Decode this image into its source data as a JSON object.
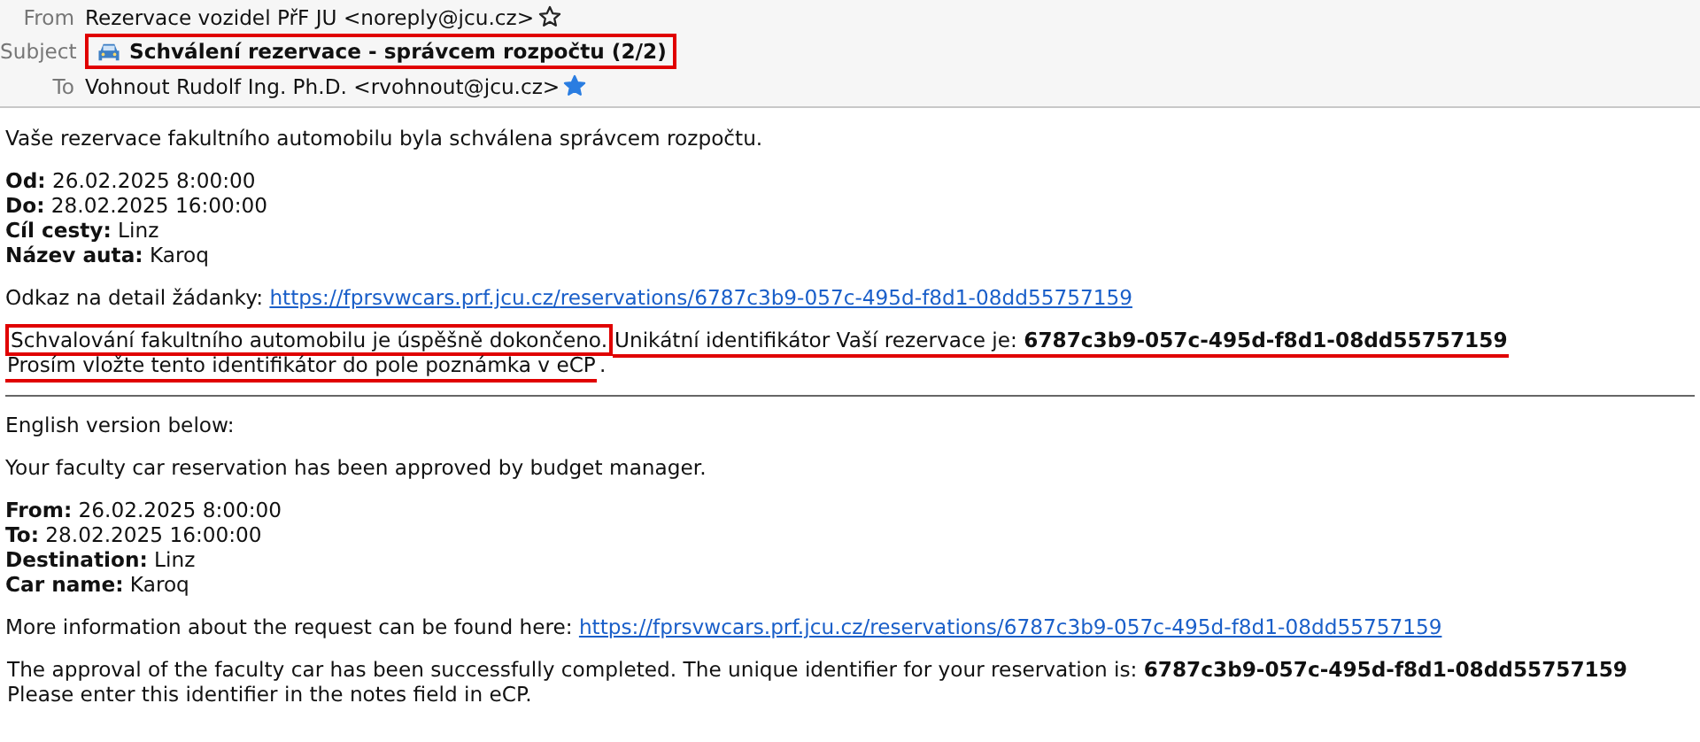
{
  "header": {
    "from": {
      "label": "From",
      "value": "Rezervace vozidel PřF JU <noreply@jcu.cz>",
      "starred": false
    },
    "subject": {
      "label": "Subject",
      "value": "Schválení rezervace - správcem rozpočtu (2/2)",
      "highlighted": true
    },
    "to": {
      "label": "To",
      "value": "Vohnout Rudolf Ing. Ph.D. <rvohnout@jcu.cz>",
      "starred": true
    }
  },
  "sections": [
    {
      "paragraphs": [
        {
          "kind": "text",
          "text": "Vaše rezervace fakultního automobilu byla schválena správcem rozpočtu."
        },
        {
          "kind": "fields",
          "lines": [
            {
              "label": "Od:",
              "value": "26.02.2025 8:00:00"
            },
            {
              "label": "Do:",
              "value": "28.02.2025 16:00:00"
            },
            {
              "label": "Cíl cesty:",
              "value": "Linz"
            },
            {
              "label": "Název auta:",
              "value": "Karoq"
            }
          ]
        },
        {
          "kind": "link",
          "text": "Odkaz na detail žádanky:",
          "url": "https://fprsvwcars.prf.jcu.cz/reservations/6787c3b9-057c-495d-f8d1-08dd55757159"
        },
        {
          "kind": "notice",
          "lines": [
            [
              {
                "text": "Schvalování fakultního automobilu je úspěšně dokončeno.",
                "boxed": true,
                "underlined": false
              },
              {
                "text": "Unikátní identifikátor Vaší rezervace je: **6787c3b9-057c-495d-f8d1-08dd55757159**",
                "boxed": false,
                "underlined": true
              }
            ],
            [
              {
                "text": "Prosím vložte tento identifikátor do pole poznámka v eCP",
                "boxed": false,
                "underlined": true
              },
              {
                "text": ".",
                "boxed": false,
                "underlined": false
              }
            ]
          ]
        }
      ]
    },
    {
      "paragraphs": [
        {
          "kind": "text",
          "text": "English version below:"
        },
        {
          "kind": "text",
          "text": "Your faculty car reservation has been approved by budget manager."
        },
        {
          "kind": "fields",
          "lines": [
            {
              "label": "From:",
              "value": "26.02.2025 8:00:00"
            },
            {
              "label": "To:",
              "value": "28.02.2025 16:00:00"
            },
            {
              "label": "Destination:",
              "value": "Linz"
            },
            {
              "label": "Car name:",
              "value": "Karoq"
            }
          ]
        },
        {
          "kind": "link",
          "text": "More information about the request can be found here:",
          "url": "https://fprsvwcars.prf.jcu.cz/reservations/6787c3b9-057c-495d-f8d1-08dd55757159"
        },
        {
          "kind": "notice",
          "lines": [
            [
              {
                "text": "The approval of the faculty car has been successfully completed. The unique identifier for your reservation is: **6787c3b9-057c-495d-f8d1-08dd55757159**",
                "boxed": false,
                "underlined": false
              }
            ],
            [
              {
                "text": "Please enter this identifier in the notes field in eCP.",
                "boxed": false,
                "underlined": false
              }
            ]
          ]
        }
      ]
    }
  ]
}
